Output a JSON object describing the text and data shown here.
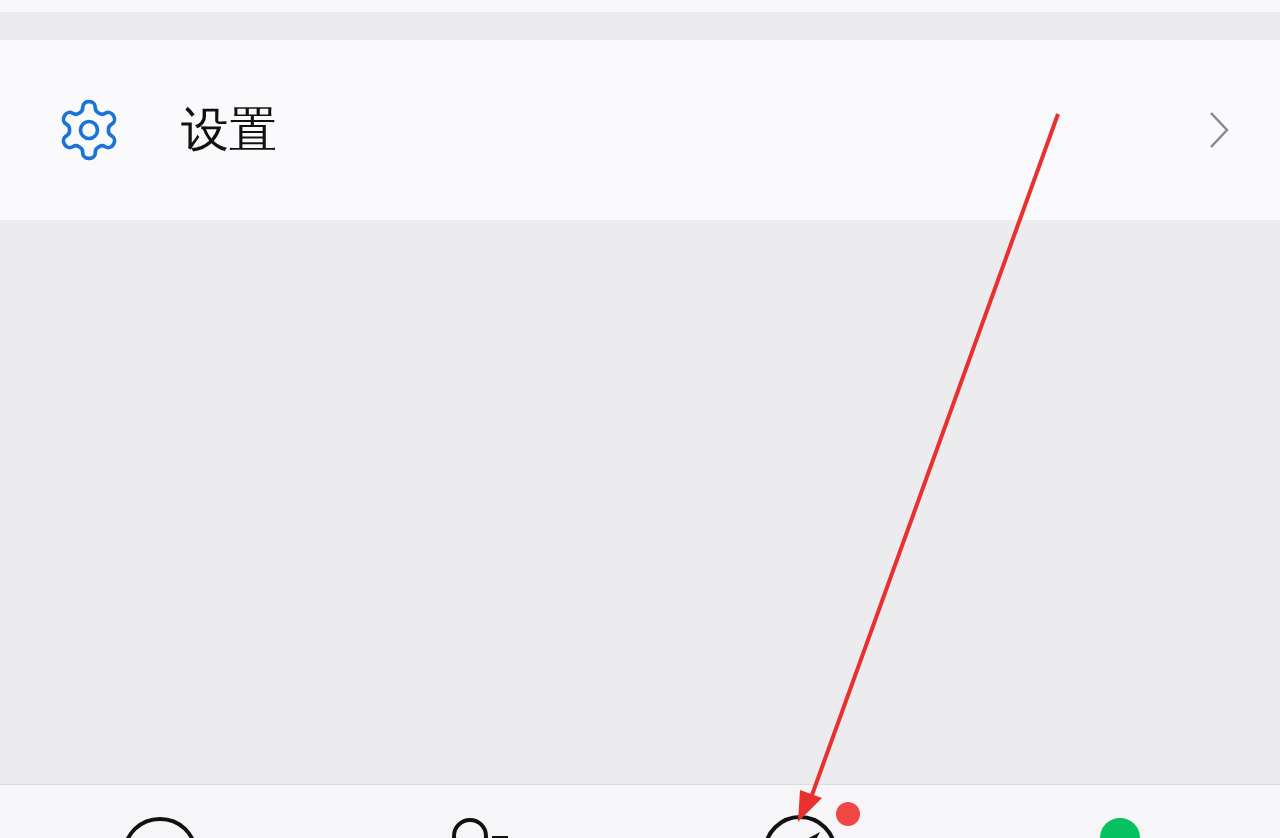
{
  "settings_row": {
    "label": "设置"
  },
  "tab_bar": {
    "tabs": [
      {
        "kind": "chats",
        "selected": false,
        "dot": false
      },
      {
        "kind": "contacts",
        "selected": false,
        "dot": false
      },
      {
        "kind": "discover",
        "selected": false,
        "dot": true
      },
      {
        "kind": "me",
        "selected": true,
        "dot": false
      }
    ]
  }
}
